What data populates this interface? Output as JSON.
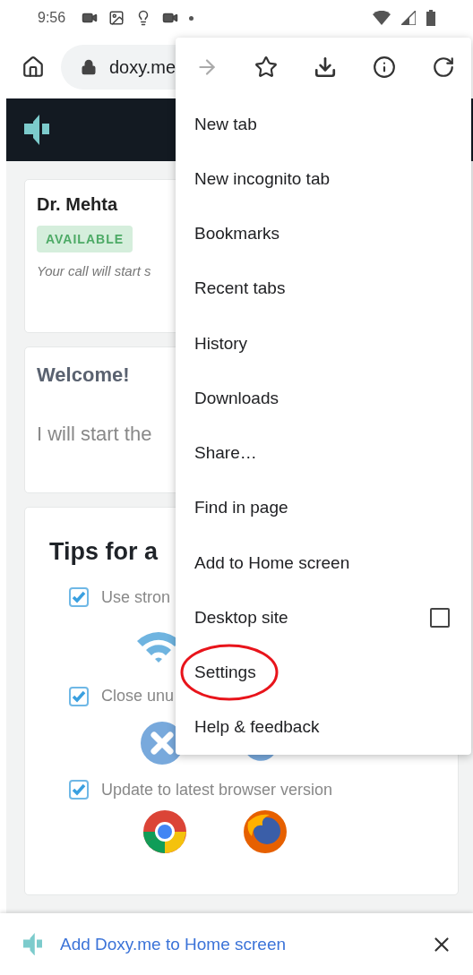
{
  "status_bar": {
    "time": "9:56"
  },
  "toolbar": {
    "url": "doxy.me"
  },
  "doctor": {
    "name": "Dr. Mehta",
    "status": "AVAILABLE",
    "note": "Your call will start s"
  },
  "welcome": {
    "title": "Welcome!",
    "text": "I will start the"
  },
  "tips": {
    "title": "Tips for a",
    "items": [
      {
        "text": "Use stron",
        "checked": true
      },
      {
        "text": "Close unu",
        "checked": true
      },
      {
        "text": "Update to latest browser version",
        "checked": true
      }
    ]
  },
  "menu": {
    "icons": [
      {
        "kind": "forward",
        "disabled": true
      },
      {
        "kind": "bookmark",
        "disabled": false
      },
      {
        "kind": "download",
        "disabled": false
      },
      {
        "kind": "info",
        "disabled": false
      },
      {
        "kind": "reload",
        "disabled": false
      }
    ],
    "items": [
      {
        "kind": "plain",
        "label": "New tab",
        "circled": false
      },
      {
        "kind": "plain",
        "label": "New incognito tab",
        "circled": false
      },
      {
        "kind": "plain",
        "label": "Bookmarks",
        "circled": false
      },
      {
        "kind": "plain",
        "label": "Recent tabs",
        "circled": false
      },
      {
        "kind": "plain",
        "label": "History",
        "circled": false
      },
      {
        "kind": "plain",
        "label": "Downloads",
        "circled": false
      },
      {
        "kind": "plain",
        "label": "Share…",
        "circled": false
      },
      {
        "kind": "plain",
        "label": "Find in page",
        "circled": false
      },
      {
        "kind": "plain",
        "label": "Add to Home screen",
        "circled": false
      },
      {
        "kind": "checkbox",
        "label": "Desktop site",
        "checked": false,
        "circled": false
      },
      {
        "kind": "plain",
        "label": "Settings",
        "circled": true
      },
      {
        "kind": "plain",
        "label": "Help & feedback",
        "circled": false
      }
    ]
  },
  "banner": {
    "text": "Add Doxy.me to Home screen"
  }
}
